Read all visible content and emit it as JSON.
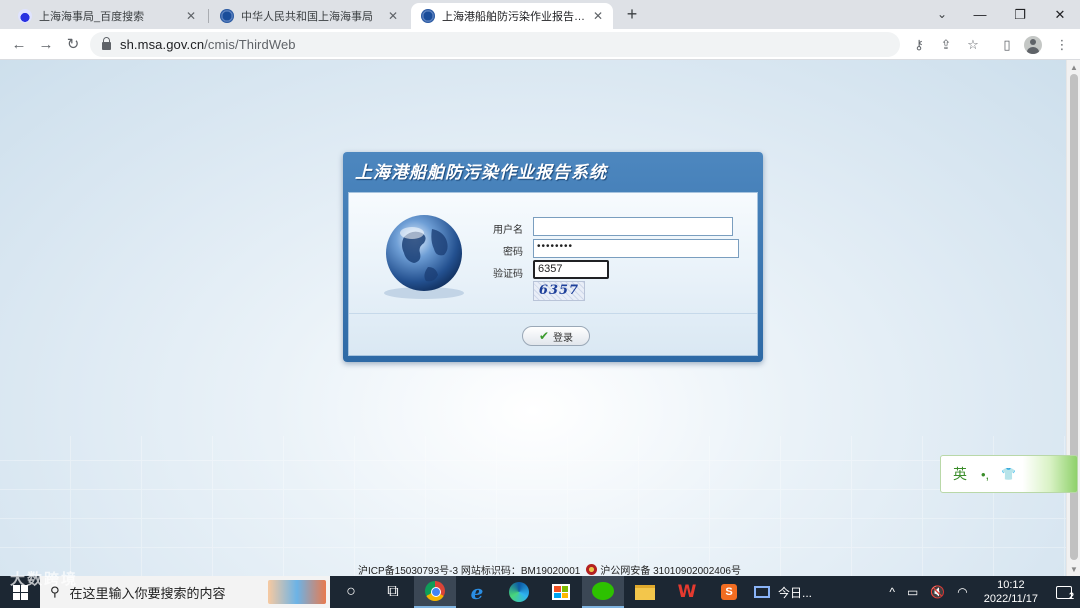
{
  "browser": {
    "tabs": [
      {
        "title": "上海海事局_百度搜索",
        "favicon": "baidu-paw-icon"
      },
      {
        "title": "中华人民共和国上海海事局",
        "favicon": "msa-emblem-icon"
      },
      {
        "title": "上海港船舶防污染作业报告系统",
        "favicon": "msa-emblem-icon",
        "active": true
      }
    ],
    "new_tab": "+",
    "url_host": "sh.msa.gov.cn",
    "url_path": "/cmis/ThirdWeb"
  },
  "login": {
    "title": "上海港船舶防污染作业报告系统",
    "username_label": "用户名",
    "username_value": "",
    "password_label": "密码",
    "password_value": "••••••••",
    "captcha_label": "验证码",
    "captcha_value": "6357",
    "captcha_image_text": "6357",
    "submit_label": "登录"
  },
  "footer": {
    "icp": "沪ICP备15030793号-3 网站标识码：BM19020001",
    "police": "沪公网安备 31010902002406号"
  },
  "ime": {
    "lang": "英",
    "punct": "•,",
    "skin_icon": "shirt-icon"
  },
  "taskbar": {
    "search_placeholder": "在这里输入你要搜索的内容",
    "news_label": "今日...",
    "time": "10:12",
    "date": "2022/11/17",
    "notification_count": "2",
    "watermark": "大数跨境"
  },
  "colors": {
    "panel_blue": "#2e6aa6",
    "page_bg": "#d8e6f1",
    "taskbar": "#1c2733"
  }
}
